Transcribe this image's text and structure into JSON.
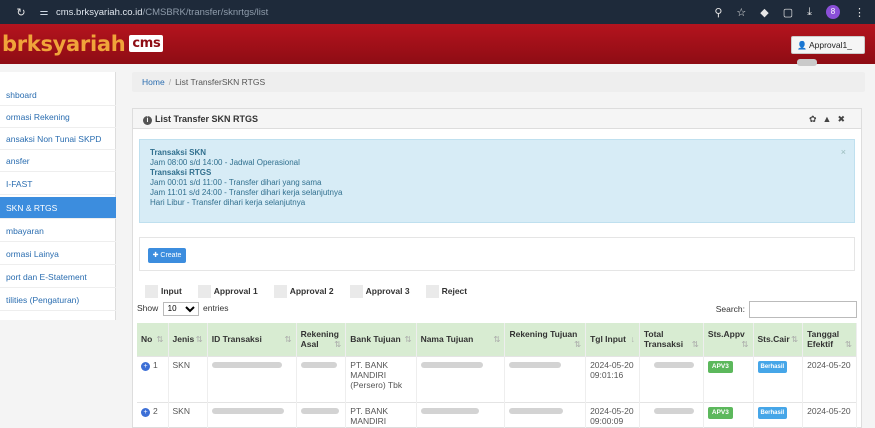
{
  "browser": {
    "reload_icon": "reload-icon",
    "url_host": "cms.brksyariah.co.id",
    "url_path": "/CMSBRK/transfer/sknrtgs/list",
    "profile_initial": "8"
  },
  "header": {
    "logo_text": "brksyariah",
    "logo_badge": "cms",
    "user_label": "Approval1_"
  },
  "sidebar": {
    "items": [
      {
        "label": "shboard",
        "active": false
      },
      {
        "label": "ormasi Rekening",
        "active": false
      },
      {
        "label": "ansaksi Non Tunai SKPD",
        "active": false
      },
      {
        "label": "ansfer",
        "active": false
      },
      {
        "label": "I-FAST",
        "active": false
      },
      {
        "label": "SKN & RTGS",
        "active": true
      },
      {
        "label": "mbayaran",
        "active": false
      },
      {
        "label": "ormasi Lainya",
        "active": false
      },
      {
        "label": "port dan E-Statement",
        "active": false
      },
      {
        "label": "tilities (Pengaturan)",
        "active": false
      }
    ]
  },
  "breadcrumb": {
    "home": "Home",
    "current": "List TransferSKN RTGS"
  },
  "panel": {
    "title": "List Transfer SKN RTGS",
    "tools": "✿ ▲ ✖",
    "close_symbol": "×"
  },
  "alert": {
    "skn_title": "Transaksi SKN",
    "skn_line1": "Jam 08:00 s/d 14:00 - Jadwal Operasional",
    "rtgs_title": "Transaksi RTGS",
    "rtgs_line1": "Jam 00:01 s/d 11:00 - Transfer dihari yang sama",
    "rtgs_line2": "Jam 11:01 s/d 24:00 - Transfer dihari kerja selanjutnya",
    "rtgs_line3": "Hari Libur - Transfer dihari kerja selanjutnya"
  },
  "create_button": "Create",
  "legend": [
    "Input",
    "Approval 1",
    "Approval 2",
    "Approval 3",
    "Reject"
  ],
  "show": {
    "prefix": "Show",
    "value": "10",
    "suffix": "entries"
  },
  "search": {
    "label": "Search:",
    "value": ""
  },
  "table": {
    "headers": [
      "No",
      "Jenis",
      "ID Transaksi",
      "Rekening Asal",
      "Bank Tujuan",
      "Nama Tujuan",
      "Rekening Tujuan",
      "Tgl Input",
      "Total Transaksi",
      "Sts.Appv",
      "Sts.Cair",
      "Tanggal Efektif"
    ],
    "rows": [
      {
        "no": "1",
        "jenis": "SKN",
        "bank_tujuan": "PT. BANK MANDIRI (Persero) Tbk",
        "tgl_input": "2024-05-20 09:01:16",
        "sts_appv": "APV3",
        "sts_cair": "Berhasil",
        "tanggal_efektif": "2024-05-20"
      },
      {
        "no": "2",
        "jenis": "SKN",
        "bank_tujuan": "PT. BANK MANDIRI (Persero) Tbk",
        "tgl_input": "2024-05-20 09:00:09",
        "sts_appv": "APV3",
        "sts_cair": "Berhasil",
        "tanggal_efektif": "2024-05-20"
      }
    ]
  }
}
